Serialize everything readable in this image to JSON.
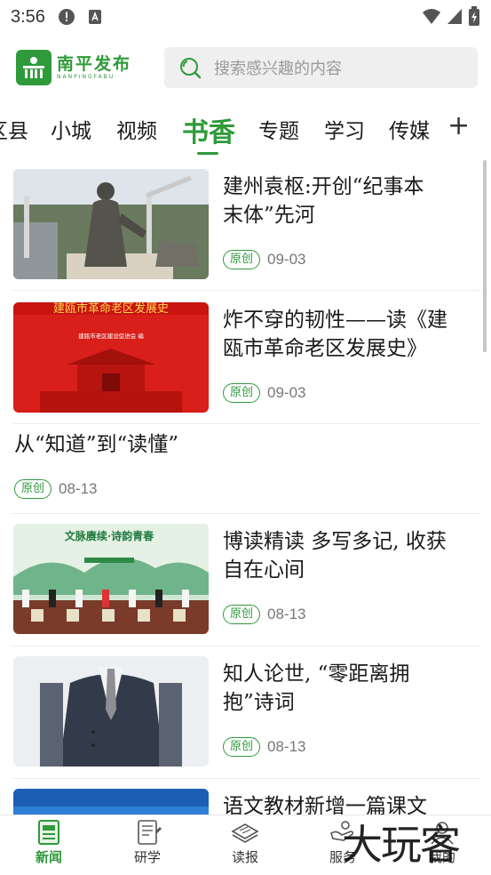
{
  "status_bar": {
    "time": "3:56"
  },
  "header": {
    "logo_title": "南平发布",
    "logo_subtitle": "NANPINGFABU",
    "search_placeholder": "搜索感兴趣的内容"
  },
  "tabs": [
    {
      "label": "区县",
      "active": false
    },
    {
      "label": "小城",
      "active": false
    },
    {
      "label": "视频",
      "active": false
    },
    {
      "label": "书香",
      "active": true
    },
    {
      "label": "专题",
      "active": false
    },
    {
      "label": "学习",
      "active": false
    },
    {
      "label": "传媒",
      "active": false
    }
  ],
  "tab_add_label": "+",
  "news": [
    {
      "title_line1": "建州袁枢:开创“纪事本",
      "title_line2": "末体”先河",
      "badge": "原创",
      "date": "09-03",
      "has_image": true,
      "image_subject": "statue-photo"
    },
    {
      "title_line1": "炸不穿的韧性——读《建",
      "title_line2": "瓯市革命老区发展史》",
      "badge": "原创",
      "date": "09-03",
      "has_image": true,
      "image_subject": "red-book-cover",
      "image_text": "建瓯市革命老区发展史",
      "image_caption": "建瓯市老区建设促进会 编"
    },
    {
      "title_line1": "从“知道”到“读懂”",
      "badge": "原创",
      "date": "08-13",
      "has_image": false
    },
    {
      "title_line1": "博读精读  多写多记, 收获",
      "title_line2": "自在心间",
      "badge": "原创",
      "date": "08-13",
      "has_image": true,
      "image_subject": "poetry-event-stage",
      "image_text": "文脉赓续·诗韵青春"
    },
    {
      "title_line1": "知人论世, “零距离拥",
      "title_line2": "抱”诗词",
      "badge": "原创",
      "date": "08-13",
      "has_image": true,
      "image_subject": "man-in-vest"
    },
    {
      "title_line1": "语文教材新增一篇课文",
      "has_image": true,
      "image_subject": "blue-image-partial"
    }
  ],
  "bottom_nav": [
    {
      "label": "新闻",
      "icon": "newspaper-icon",
      "active": true
    },
    {
      "label": "研学",
      "icon": "notebook-icon",
      "active": false
    },
    {
      "label": "读报",
      "icon": "reading-icon",
      "active": false
    },
    {
      "label": "服务",
      "icon": "service-hand-icon",
      "active": false
    },
    {
      "label": "我的",
      "icon": "profile-icon",
      "active": false
    }
  ],
  "watermark": "大玩客",
  "colors": {
    "brand_green": "#2e9a3a",
    "text": "#1a1a1a",
    "muted": "#777777"
  }
}
